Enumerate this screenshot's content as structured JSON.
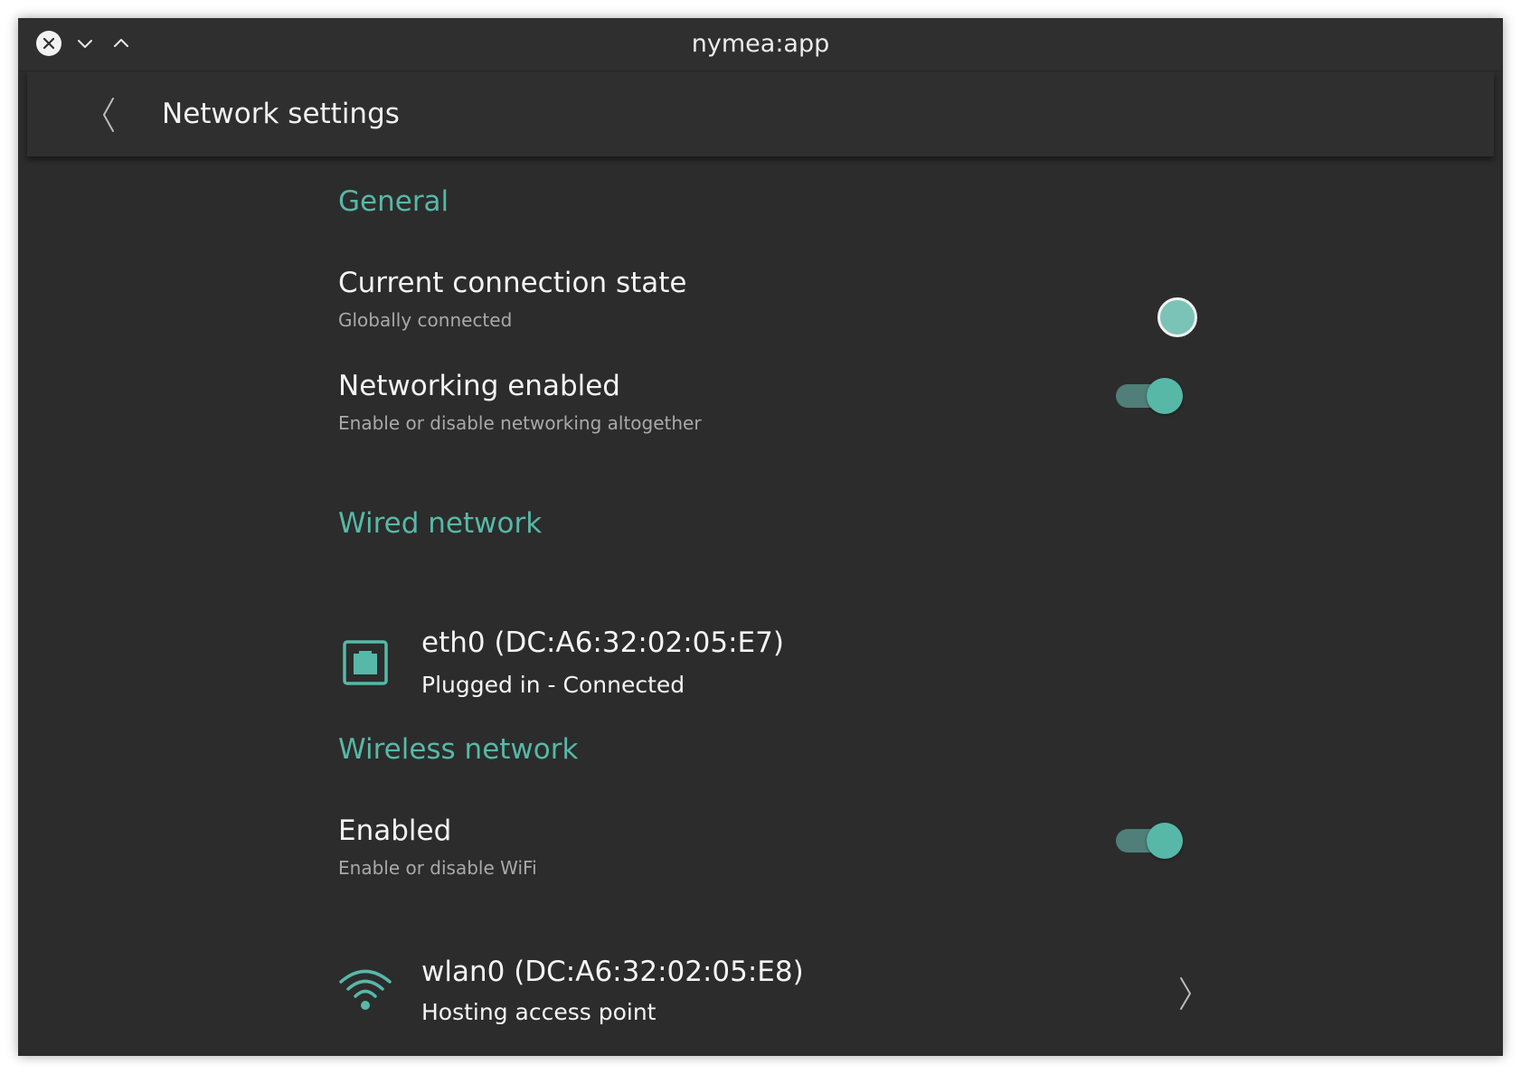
{
  "window": {
    "title": "nymea:app",
    "controls": [
      "close-icon",
      "chevron-down-icon",
      "chevron-up-icon"
    ]
  },
  "header": {
    "back_icon": "chevron-left-icon",
    "title": "Network settings"
  },
  "general": {
    "section_title": "General",
    "connection_state": {
      "title": "Current connection state",
      "subtitle": "Globally connected",
      "indicator_color": "#7cc3b7"
    },
    "networking": {
      "title": "Networking enabled",
      "subtitle": "Enable or disable networking altogether",
      "enabled": true
    }
  },
  "wired": {
    "section_title": "Wired network",
    "devices": [
      {
        "icon": "ethernet-port-icon",
        "name": "eth0 (DC:A6:32:02:05:E7)",
        "status": "Plugged in - Connected"
      }
    ]
  },
  "wireless": {
    "section_title": "Wireless network",
    "enabled_row": {
      "title": "Enabled",
      "subtitle": "Enable or disable WiFi",
      "enabled": true
    },
    "devices": [
      {
        "icon": "wifi-icon",
        "name": "wlan0 (DC:A6:32:02:05:E8)",
        "status": "Hosting access point",
        "action_icon": "chevron-right-icon"
      }
    ]
  },
  "colors": {
    "accent": "#57b8a8",
    "background": "#2c2c2c",
    "header": "#2f2f2f",
    "text": "#f4f4f4",
    "subtext": "#a9a9a9"
  }
}
